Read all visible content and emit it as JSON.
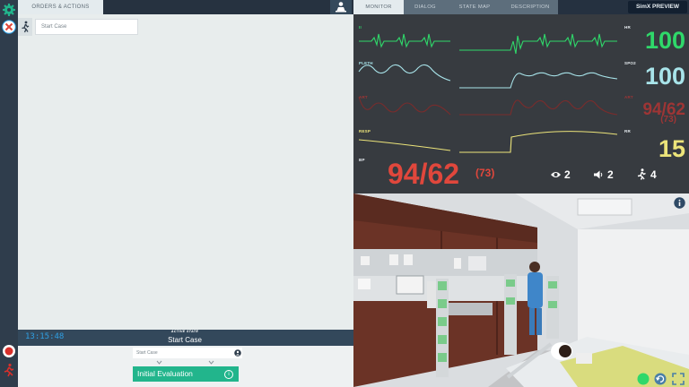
{
  "left_panel": {
    "tab_label": "ORDERS & ACTIONS",
    "start_input_placeholder": "Start Case"
  },
  "state_bar": {
    "clock": "13:15:48",
    "active_label": "ACTIVE STATE",
    "active_value": "Start Case",
    "select_placeholder": "Start Case",
    "initial_evaluation": "Initial Evaluation",
    "info_glyph": "i"
  },
  "right_tabs": {
    "monitor": "MONITOR",
    "dialog": "DIALOG",
    "state_map": "STATE MAP",
    "description": "DESCRIPTION",
    "simx": "SimX PREVIEW"
  },
  "monitor": {
    "hr_label": "HR",
    "hr_value": "100",
    "spo2_label": "SPO2",
    "spo2_value": "100",
    "art_label": "ART",
    "art_value": "94/62",
    "art_mean": "(73)",
    "rr_label": "RR",
    "rr_value": "15",
    "ecg_label": "II",
    "pleth_label": "PLETH",
    "resp_label": "RESP",
    "bp_label": "BP",
    "bp_value": "94/62",
    "bp_mean": "(73)",
    "eye_count": "2",
    "sound_count": "2",
    "walk_count": "4",
    "colors": {
      "green": "#2fd86a",
      "cyan": "#a8e4ea",
      "red": "#e0473c",
      "dim_red": "#9e3535",
      "yellow": "#ece47a"
    }
  },
  "icons": [
    "gear-icon",
    "close-icon",
    "record-icon",
    "running-person-icon",
    "avatar-icon",
    "eye-icon",
    "speaker-icon",
    "info-icon",
    "undo-icon",
    "expand-icon"
  ]
}
